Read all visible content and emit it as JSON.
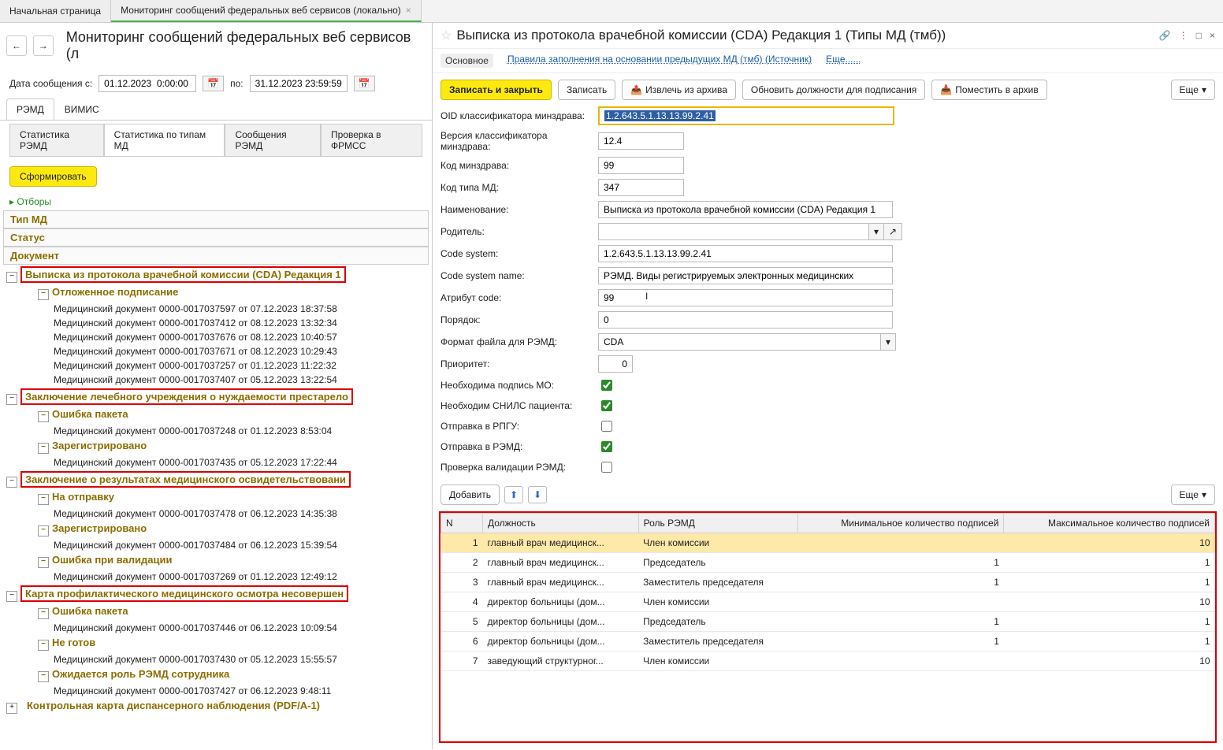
{
  "tabs": {
    "home": "Начальная страница",
    "monitoring": "Мониторинг сообщений федеральных веб сервисов (локально)"
  },
  "left": {
    "nav_back": "←",
    "nav_fwd": "→",
    "page_title": "Мониторинг сообщений федеральных веб сервисов (л",
    "filter_label_from": "Дата сообщения с:",
    "filter_from": "01.12.2023  0:00:00",
    "filter_label_to": "по:",
    "filter_to": "31.12.2023 23:59:59",
    "subtabs": {
      "remd": "РЭМД",
      "vimis": "ВИМИС"
    },
    "subtabs2": {
      "stat_remd": "Статистика РЭМД",
      "stat_types": "Статистика по типам МД",
      "msg_remd": "Сообщения РЭМД",
      "check": "Проверка в ФРМСС"
    },
    "form_btn": "Сформировать",
    "otbory": "Отборы",
    "tree": {
      "hdr_tip": "Тип МД",
      "hdr_status": "Статус",
      "hdr_doc": "Документ",
      "g1": "Выписка из протокола врачебной комиссии (CDA) Редакция 1",
      "g1_items": [
        "Отложенное подписание",
        "Медицинский документ 0000-0017037597 от 07.12.2023 18:37:58",
        "Медицинский документ 0000-0017037412 от 08.12.2023 13:32:34",
        "Медицинский документ 0000-0017037676 от 08.12.2023 10:40:57",
        "Медицинский документ 0000-0017037671 от 08.12.2023 10:29:43",
        "Медицинский документ 0000-0017037257 от 01.12.2023 11:22:32",
        "Медицинский документ 0000-0017037407 от 05.12.2023 13:22:54"
      ],
      "g2": "Заключение лечебного учреждения о нуждаемости престарело",
      "g2_status": "Ошибка пакета",
      "g2_item": "Медицинский документ 0000-0017037248 от 01.12.2023 8:53:04",
      "g2b_status": "Зарегистрировано",
      "g2b_item": "Медицинский документ 0000-0017037435 от 05.12.2023 17:22:44",
      "g3": "Заключение о результатах медицинского освидетельствовани",
      "g3_status1": "На отправку",
      "g3_item1": "Медицинский документ 0000-0017037478 от 06.12.2023 14:35:38",
      "g3_status2": "Зарегистрировано",
      "g3_item2": "Медицинский документ 0000-0017037484 от 06.12.2023 15:39:54",
      "g3_status3": "Ошибка при валидации",
      "g3_item3": "Медицинский документ 0000-0017037269 от 01.12.2023 12:49:12",
      "g4": "Карта профилактического медицинского осмотра несовершен",
      "g4_status1": "Ошибка пакета",
      "g4_item1": "Медицинский документ 0000-0017037446 от 06.12.2023 10:09:54",
      "g4_status2": "Не готов",
      "g4_item2": "Медицинский документ 0000-0017037430 от 05.12.2023 15:55:57",
      "g4_status3": "Ожидается роль РЭМД сотрудника",
      "g4_item3": "Медицинский документ 0000-0017037427 от 06.12.2023 9:48:11",
      "g5": "Контрольная карта диспансерного наблюдения (PDF/A-1)"
    }
  },
  "right": {
    "title": "Выписка из протокола врачебной комиссии (CDA) Редакция 1 (Типы МД (тмб))",
    "nav": {
      "main": "Основное",
      "rules": "Правила заполнения на основании предыдущих МД (тмб) (Источник)",
      "more": "Еще......"
    },
    "toolbar": {
      "save_close": "Записать и закрыть",
      "save": "Записать",
      "extract": "Извлечь из архива",
      "update": "Обновить должности для подписания",
      "archive": "Поместить в архив",
      "more": "Еще"
    },
    "fields": {
      "oid_label": "OID классификатора минздрава:",
      "oid": "1.2.643.5.1.13.13.99.2.41",
      "ver_label": "Версия классификатора минздрава:",
      "ver": "12.4",
      "code_label": "Код минздрава:",
      "code": "99",
      "type_label": "Код типа МД:",
      "type": "347",
      "name_label": "Наименование:",
      "name": "Выписка из протокола врачебной комиссии (CDA) Редакция 1",
      "parent_label": "Родитель:",
      "parent": "",
      "cs_label": "Code system:",
      "cs": "1.2.643.5.1.13.13.99.2.41",
      "csn_label": "Code system name:",
      "csn": "РЭМД. Виды регистрируемых электронных медицинских",
      "attr_label": "Атрибут code:",
      "attr": "99",
      "order_label": "Порядок:",
      "order": "0",
      "fmt_label": "Формат файла для РЭМД:",
      "fmt": "CDA",
      "prio_label": "Приоритет:",
      "prio": "0",
      "sign_mo": "Необходима подпись МО:",
      "snils": "Необходим СНИЛС пациента:",
      "rpgu": "Отправка в РПГУ:",
      "remd": "Отправка в РЭМД:",
      "valid": "Проверка валидации РЭМД:"
    },
    "table_toolbar": {
      "add": "Добавить",
      "more": "Еще"
    },
    "table": {
      "h_n": "N",
      "h_pos": "Должность",
      "h_role": "Роль РЭМД",
      "h_min": "Минимальное количество подписей",
      "h_max": "Максимальное количество подписей",
      "rows": [
        {
          "n": "1",
          "pos": "главный врач медицинск...",
          "role": "Член комиссии",
          "min": "",
          "max": "10"
        },
        {
          "n": "2",
          "pos": "главный врач медицинск...",
          "role": "Председатель",
          "min": "1",
          "max": "1"
        },
        {
          "n": "3",
          "pos": "главный врач медицинск...",
          "role": "Заместитель председателя",
          "min": "1",
          "max": "1"
        },
        {
          "n": "4",
          "pos": "директор больницы (дом...",
          "role": "Член комиссии",
          "min": "",
          "max": "10"
        },
        {
          "n": "5",
          "pos": "директор больницы (дом...",
          "role": "Председатель",
          "min": "1",
          "max": "1"
        },
        {
          "n": "6",
          "pos": "директор больницы (дом...",
          "role": "Заместитель председателя",
          "min": "1",
          "max": "1"
        },
        {
          "n": "7",
          "pos": "заведующий структурног...",
          "role": "Член комиссии",
          "min": "",
          "max": "10"
        }
      ]
    }
  }
}
